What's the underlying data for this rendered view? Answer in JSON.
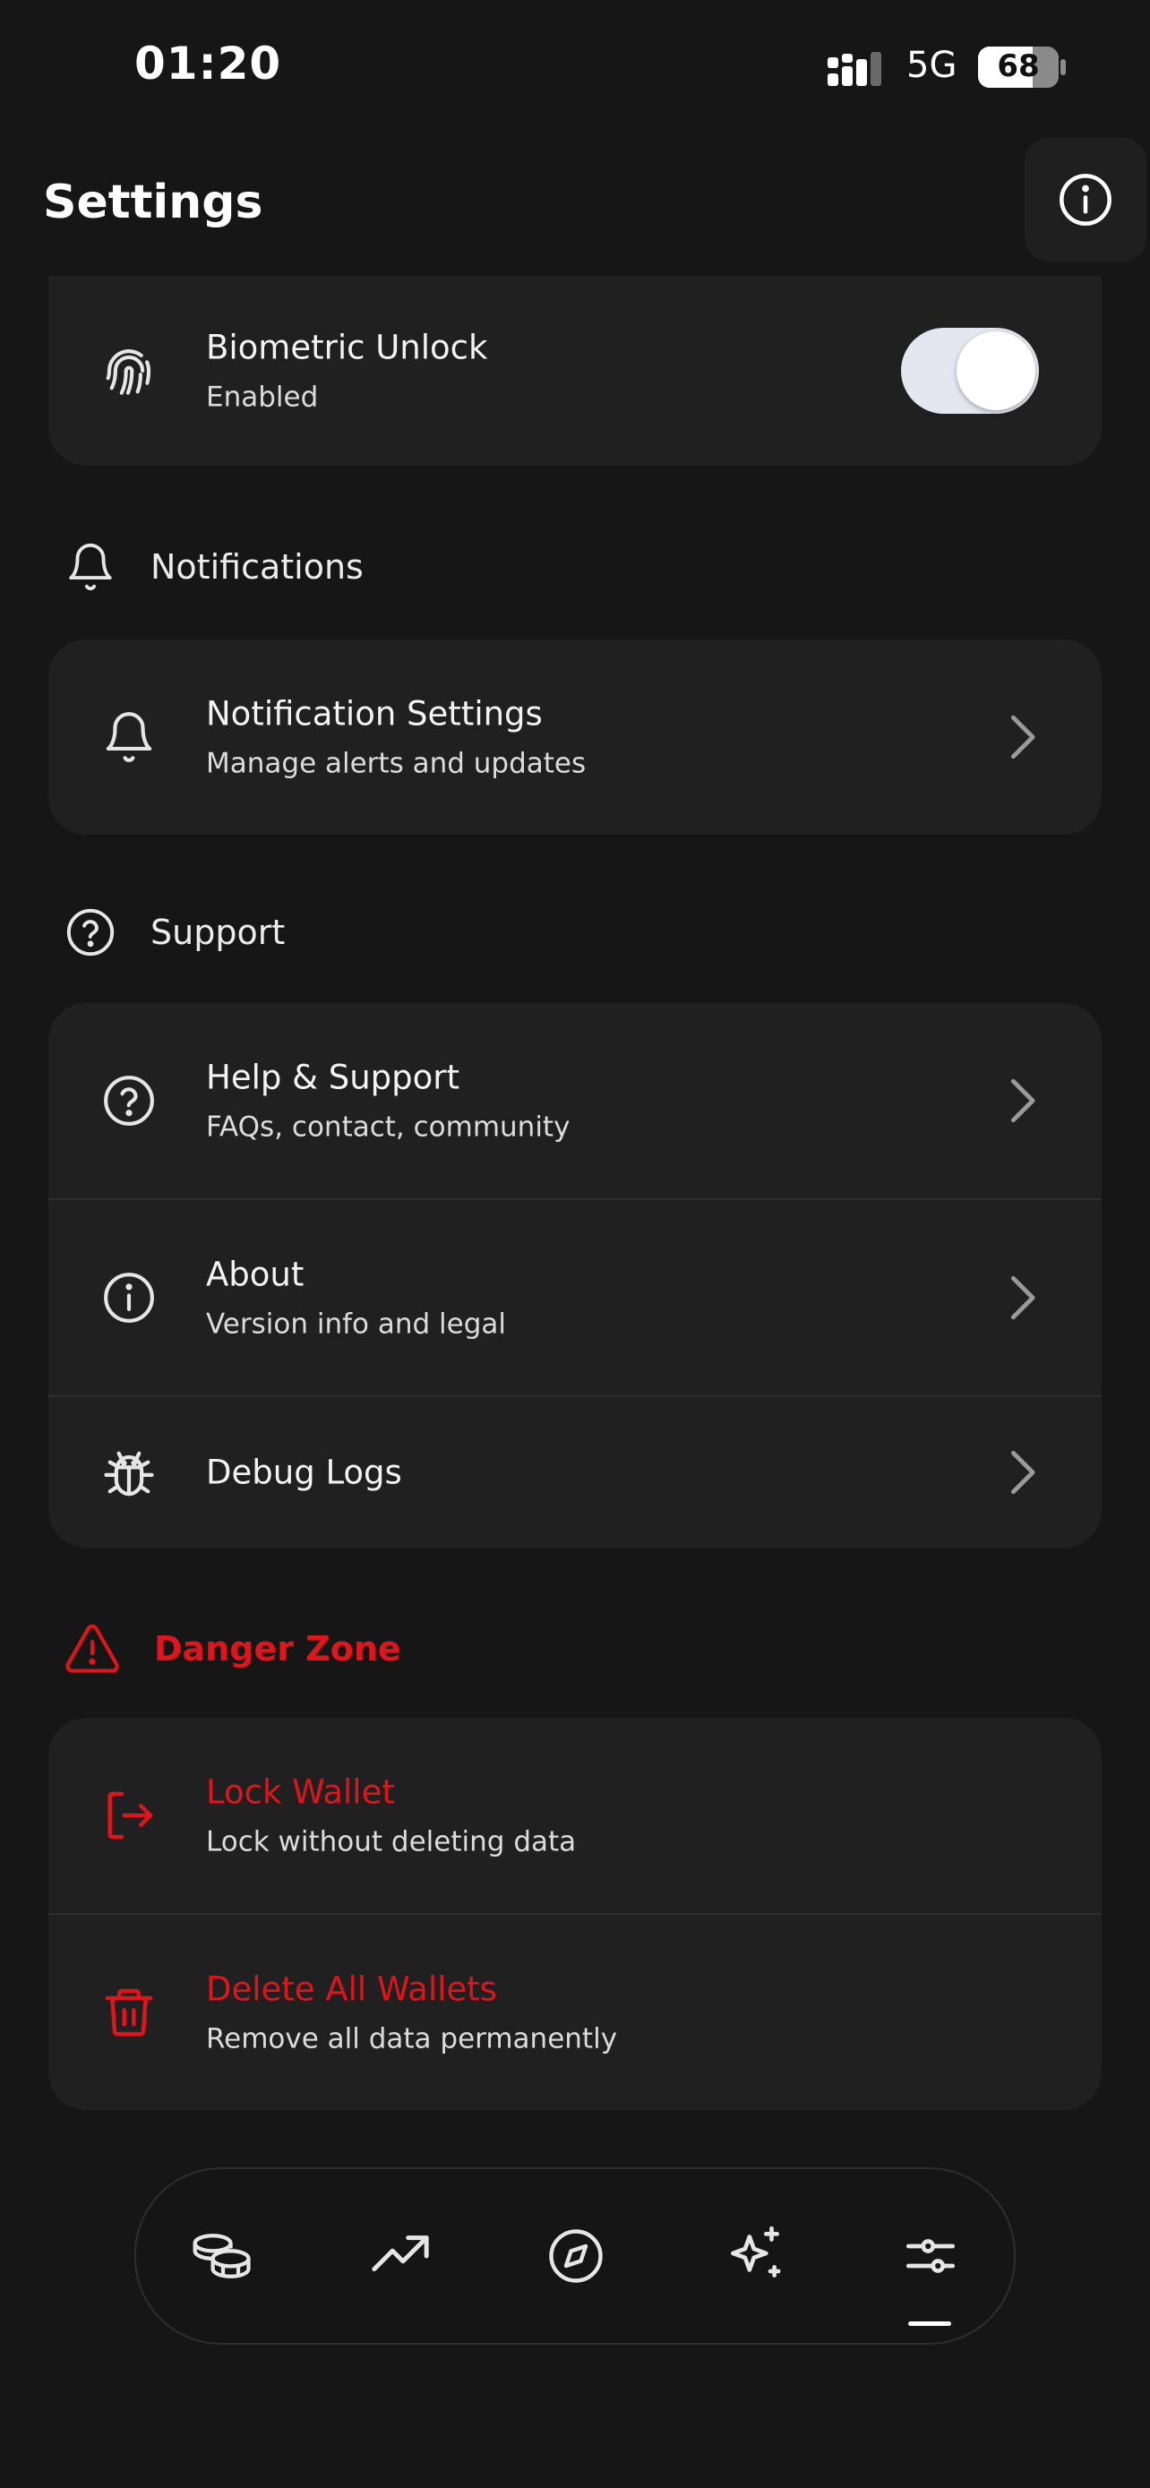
{
  "status_bar": {
    "time": "01:20",
    "network": "5G",
    "battery_percent": "68",
    "battery_level": 0.68
  },
  "header": {
    "title": "Settings",
    "info_icon": "info-circle-icon"
  },
  "security": {
    "biometric": {
      "title": "Biometric Unlock",
      "subtitle": "Enabled",
      "icon": "fingerprint-icon",
      "enabled": true
    }
  },
  "notifications": {
    "section_label": "Notifications",
    "items": [
      {
        "title": "Notification Settings",
        "subtitle": "Manage alerts and updates",
        "icon": "bell-icon"
      }
    ]
  },
  "support": {
    "section_label": "Support",
    "items": [
      {
        "title": "Help & Support",
        "subtitle": "FAQs, contact, community",
        "icon": "help-circle-icon"
      },
      {
        "title": "About",
        "subtitle": "Version info and legal",
        "icon": "info-circle-icon"
      },
      {
        "title": "Debug Logs",
        "icon": "bug-icon"
      }
    ]
  },
  "danger": {
    "section_label": "Danger Zone",
    "color": "#e0141b",
    "items": [
      {
        "title": "Lock Wallet",
        "subtitle": "Lock without deleting data",
        "icon": "logout-icon"
      },
      {
        "title": "Delete All Wallets",
        "subtitle": "Remove all data permanently",
        "icon": "trash-icon"
      }
    ]
  },
  "tab_bar": {
    "tabs": [
      {
        "icon": "coins-icon",
        "active": false
      },
      {
        "icon": "trending-up-icon",
        "active": false
      },
      {
        "icon": "compass-icon",
        "active": false
      },
      {
        "icon": "sparkles-icon",
        "active": false
      },
      {
        "icon": "sliders-icon",
        "active": true
      }
    ]
  },
  "colors": {
    "background": "#161616",
    "card": "#202020",
    "danger": "#e0141b",
    "toggle_on": "#e6e6f0"
  }
}
